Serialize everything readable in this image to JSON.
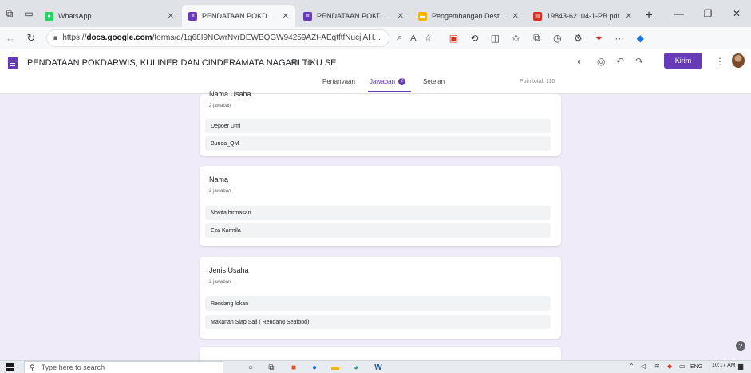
{
  "browser": {
    "tabs": [
      {
        "title": "WhatsApp",
        "fav_color": "#25d366",
        "fav_icon": "whatsapp-icon",
        "active": false
      },
      {
        "title": "PENDATAAN POKDARW",
        "fav_color": "#673ab7",
        "fav_icon": "forms-icon",
        "active": true
      },
      {
        "title": "PENDATAAN POKDARW",
        "fav_color": "#673ab7",
        "fav_icon": "forms-icon",
        "active": false
      },
      {
        "title": "Pengembangan Destina",
        "fav_color": "#f4b400",
        "fav_icon": "slides-icon",
        "active": false
      },
      {
        "title": "19843-62104-1-PB.pdf",
        "fav_color": "#d93025",
        "fav_icon": "pdf-icon",
        "active": false
      }
    ],
    "url_prefix": "https://",
    "url_domain": "docs.google.com",
    "url_path": "/forms/d/1g68I9NCwrNvrDEWBQGW94259AZt-AEgtftfNucjlAH..."
  },
  "form": {
    "title": "PENDATAAN POKDARWIS, KULINER DAN CINDERAMATA NAGARI TIKU SE",
    "send_label": "Kirim",
    "tabs": {
      "questions": "Pertanyaan",
      "responses": "Jawaban",
      "responses_badge": "2",
      "settings": "Setelan"
    },
    "points_total": "Poin total: 110"
  },
  "questions": [
    {
      "title": "Nama Usaha",
      "count": "2 jawaban",
      "answers": [
        "Depoer Umi",
        "Bunda_QM"
      ]
    },
    {
      "title": "Nama",
      "count": "2 jawaban",
      "answers": [
        "Novita birmasari",
        "Eza Karmila"
      ]
    },
    {
      "title": "Jenis Usaha",
      "count": "2 jawaban",
      "answers": [
        "Rendang lokan",
        "Makanan Siap Saji ( Rendang Seafood)"
      ]
    }
  ],
  "taskbar": {
    "search_placeholder": "Type here to search",
    "language": "ENG",
    "time": "10:17 AM"
  }
}
